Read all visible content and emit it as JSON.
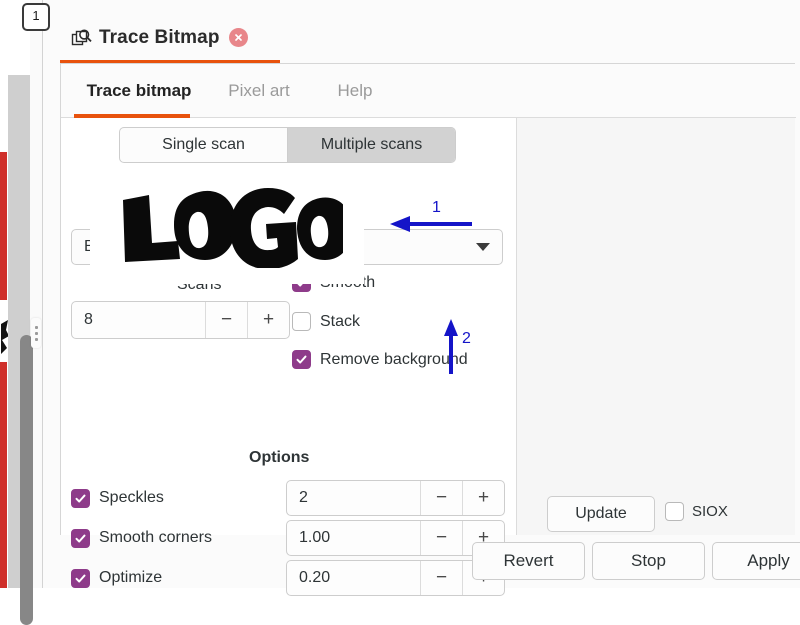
{
  "app": {
    "badge": "1"
  },
  "dialog": {
    "title": "Trace Bitmap",
    "icon": "trace-bitmap-icon",
    "close_icon": "close-icon",
    "accent_color": "#e8520d"
  },
  "tabs": [
    {
      "label": "Trace bitmap",
      "active": true
    },
    {
      "label": "Pixel art",
      "active": false
    },
    {
      "label": "Help",
      "active": false
    }
  ],
  "scan_mode": {
    "options": [
      "Single scan",
      "Multiple scans"
    ],
    "selected": "Multiple scans"
  },
  "detection_mode": {
    "value": "Brightness steps",
    "caret_icon": "chevron-down-icon"
  },
  "scans": {
    "label": "Scans",
    "value": "8",
    "minus_icon": "minus-icon",
    "plus_icon": "plus-icon"
  },
  "flags": [
    {
      "name": "smooth",
      "label": "Smooth",
      "checked": true
    },
    {
      "name": "stack",
      "label": "Stack",
      "checked": false
    },
    {
      "name": "remove-background",
      "label": "Remove background",
      "checked": true
    }
  ],
  "options": {
    "title": "Options",
    "rows": [
      {
        "name": "speckles",
        "label": "Speckles",
        "checked": true,
        "value": "2"
      },
      {
        "name": "smooth-corners",
        "label": "Smooth corners",
        "checked": true,
        "value": "1.00"
      },
      {
        "name": "optimize",
        "label": "Optimize",
        "checked": true,
        "value": "0.20"
      }
    ]
  },
  "preview": {
    "text": "LOGO",
    "update_label": "Update",
    "siox_label": "SIOX",
    "siox_checked": false
  },
  "actions": [
    {
      "name": "revert",
      "label": "Revert"
    },
    {
      "name": "stop",
      "label": "Stop"
    },
    {
      "name": "apply",
      "label": "Apply"
    }
  ],
  "annotations": [
    {
      "id": "1",
      "label": "1",
      "direction": "left"
    },
    {
      "id": "2",
      "label": "2",
      "direction": "up"
    }
  ],
  "colors": {
    "accent_orange": "#e8520d",
    "checkbox_purple": "#8e3b8a",
    "annotation_blue": "#1414c8",
    "close_pink": "#e8868a",
    "canvas_red": "#cf2f2a"
  }
}
